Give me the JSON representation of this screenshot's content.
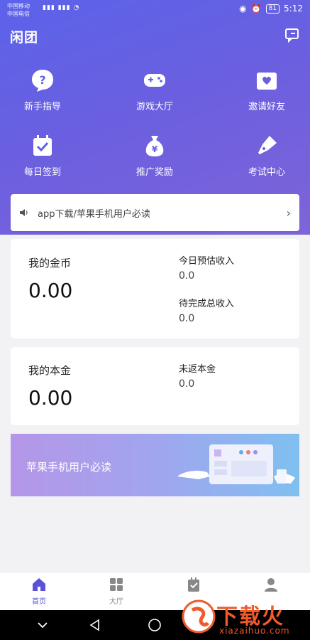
{
  "status_bar": {
    "carrier1": "中国移动",
    "carrier2": "中国电信",
    "battery": "81",
    "time": "5:12"
  },
  "header": {
    "app_name": "闲团"
  },
  "quick_grid": [
    {
      "label": "新手指导",
      "icon": "question-icon"
    },
    {
      "label": "游戏大厅",
      "icon": "gamepad-icon"
    },
    {
      "label": "邀请好友",
      "icon": "heart-mail-icon"
    },
    {
      "label": "每日签到",
      "icon": "calendar-check-icon"
    },
    {
      "label": "推广奖励",
      "icon": "money-bag-icon"
    },
    {
      "label": "考试中心",
      "icon": "pen-nib-icon"
    }
  ],
  "notice": {
    "text": "app下载/苹果手机用户必读"
  },
  "coins_card": {
    "title": "我的金币",
    "value": "0.00",
    "today_label": "今日预估收入",
    "today_value": "0.0",
    "pending_label": "待完成总收入",
    "pending_value": "0.0"
  },
  "principal_card": {
    "title": "我的本金",
    "value": "0.00",
    "unreturned_label": "未返本金",
    "unreturned_value": "0.0"
  },
  "banner": {
    "text": "苹果手机用户必读"
  },
  "tabbar": [
    {
      "label": "首页",
      "icon": "home-icon",
      "active": true
    },
    {
      "label": "大厅",
      "icon": "grid-icon",
      "active": false
    },
    {
      "label": "",
      "icon": "task-icon",
      "active": false
    },
    {
      "label": "",
      "icon": "user-icon",
      "active": false
    }
  ],
  "watermark": {
    "text": "下载火",
    "url": "xiazaihuo.com"
  },
  "colors": {
    "accent": "#5a52d8",
    "hero_start": "#5b63ea",
    "hero_end": "#7e64d8",
    "watermark": "#f25a2a"
  }
}
